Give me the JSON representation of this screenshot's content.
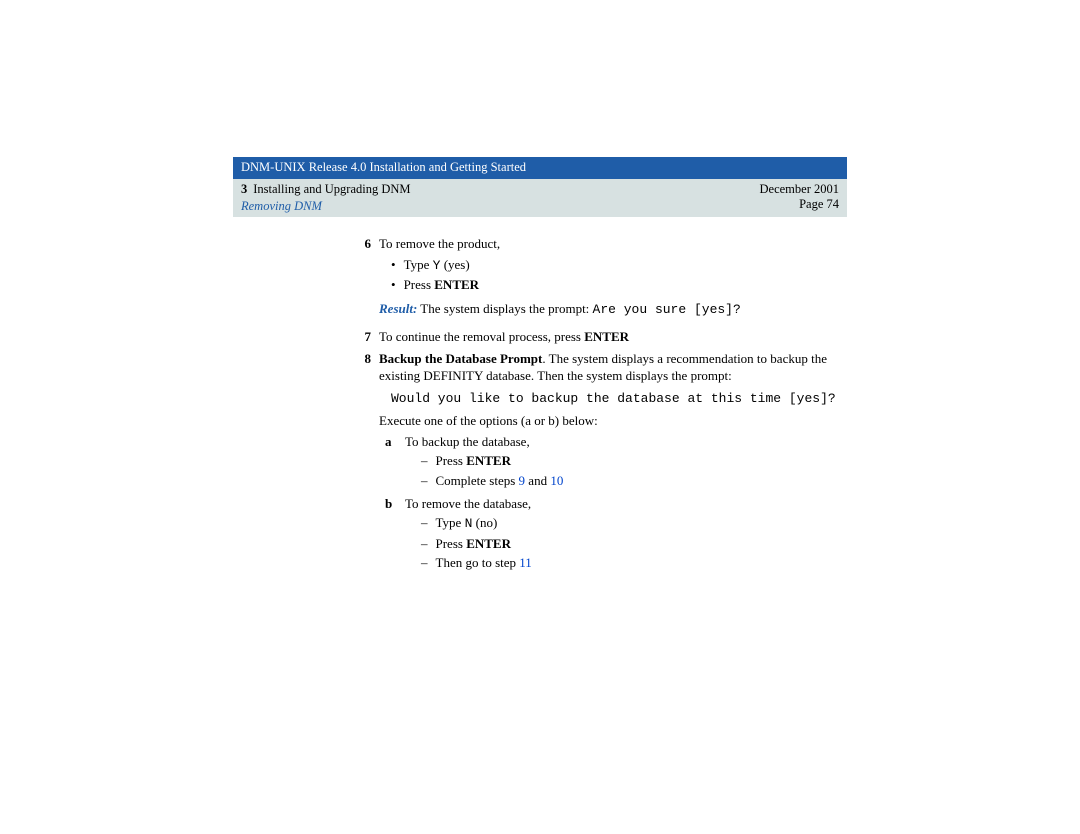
{
  "header": {
    "doc_title": "DNM-UNIX Release 4.0 Installation and Getting Started",
    "chapter_num": "3",
    "chapter_title": "Installing and Upgrading DNM",
    "section": "Removing DNM",
    "date": "December 2001",
    "page": "Page 74"
  },
  "step6": {
    "num": "6",
    "text": "To remove the product,",
    "bullet1_pre": "Type ",
    "bullet1_code": " Y",
    "bullet1_post": " (yes)",
    "bullet2_pre": "Press ",
    "bullet2_bold": "ENTER",
    "result_label": "Result:",
    "result_text": " The system displays the prompt: ",
    "result_code": "Are you sure [yes]?"
  },
  "step7": {
    "num": "7",
    "text": "To continue the removal process, press ",
    "bold": "ENTER"
  },
  "step8": {
    "num": "8",
    "title": "Backup the Database Prompt",
    "text": ". The system displays a recommendation to backup the existing DEFINITY database. Then the system displays the prompt:",
    "code": "Would you like to backup the database at this time [yes]?",
    "exec": "Execute one of the options (a or b) below:",
    "a_label": "a",
    "a_text": "To backup the database,",
    "a_d1_pre": "Press ",
    "a_d1_bold": "ENTER",
    "a_d2_pre": "Complete steps ",
    "a_d2_link1": "9",
    "a_d2_mid": " and ",
    "a_d2_link2": "10",
    "b_label": "b",
    "b_text": "To remove the database,",
    "b_d1_pre": "Type ",
    "b_d1_code": " N",
    "b_d1_post": " (no)",
    "b_d2_pre": "Press ",
    "b_d2_bold": "ENTER",
    "b_d3_pre": "Then go to step ",
    "b_d3_link": "11"
  }
}
